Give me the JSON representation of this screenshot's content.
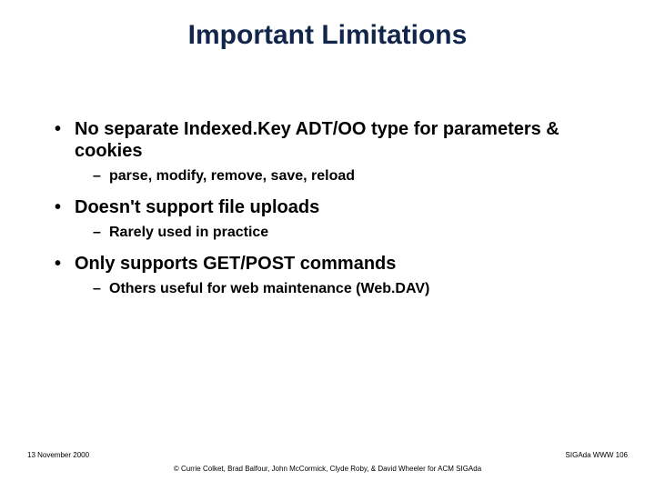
{
  "title": "Important Limitations",
  "bullets": {
    "item1": {
      "text": "No separate Indexed.Key ADT/OO type for parameters & cookies",
      "sub": "parse, modify, remove, save, reload"
    },
    "item2": {
      "text": "Doesn't support file uploads",
      "sub": "Rarely used in practice"
    },
    "item3": {
      "text": "Only supports GET/POST commands",
      "sub": "Others useful for web maintenance (Web.DAV)"
    }
  },
  "footer": {
    "date": "13 November 2000",
    "page": "SIGAda WWW 106",
    "credit": "© Currie Colket, Brad Balfour, John McCormick, Clyde Roby, & David Wheeler for ACM SIGAda"
  }
}
